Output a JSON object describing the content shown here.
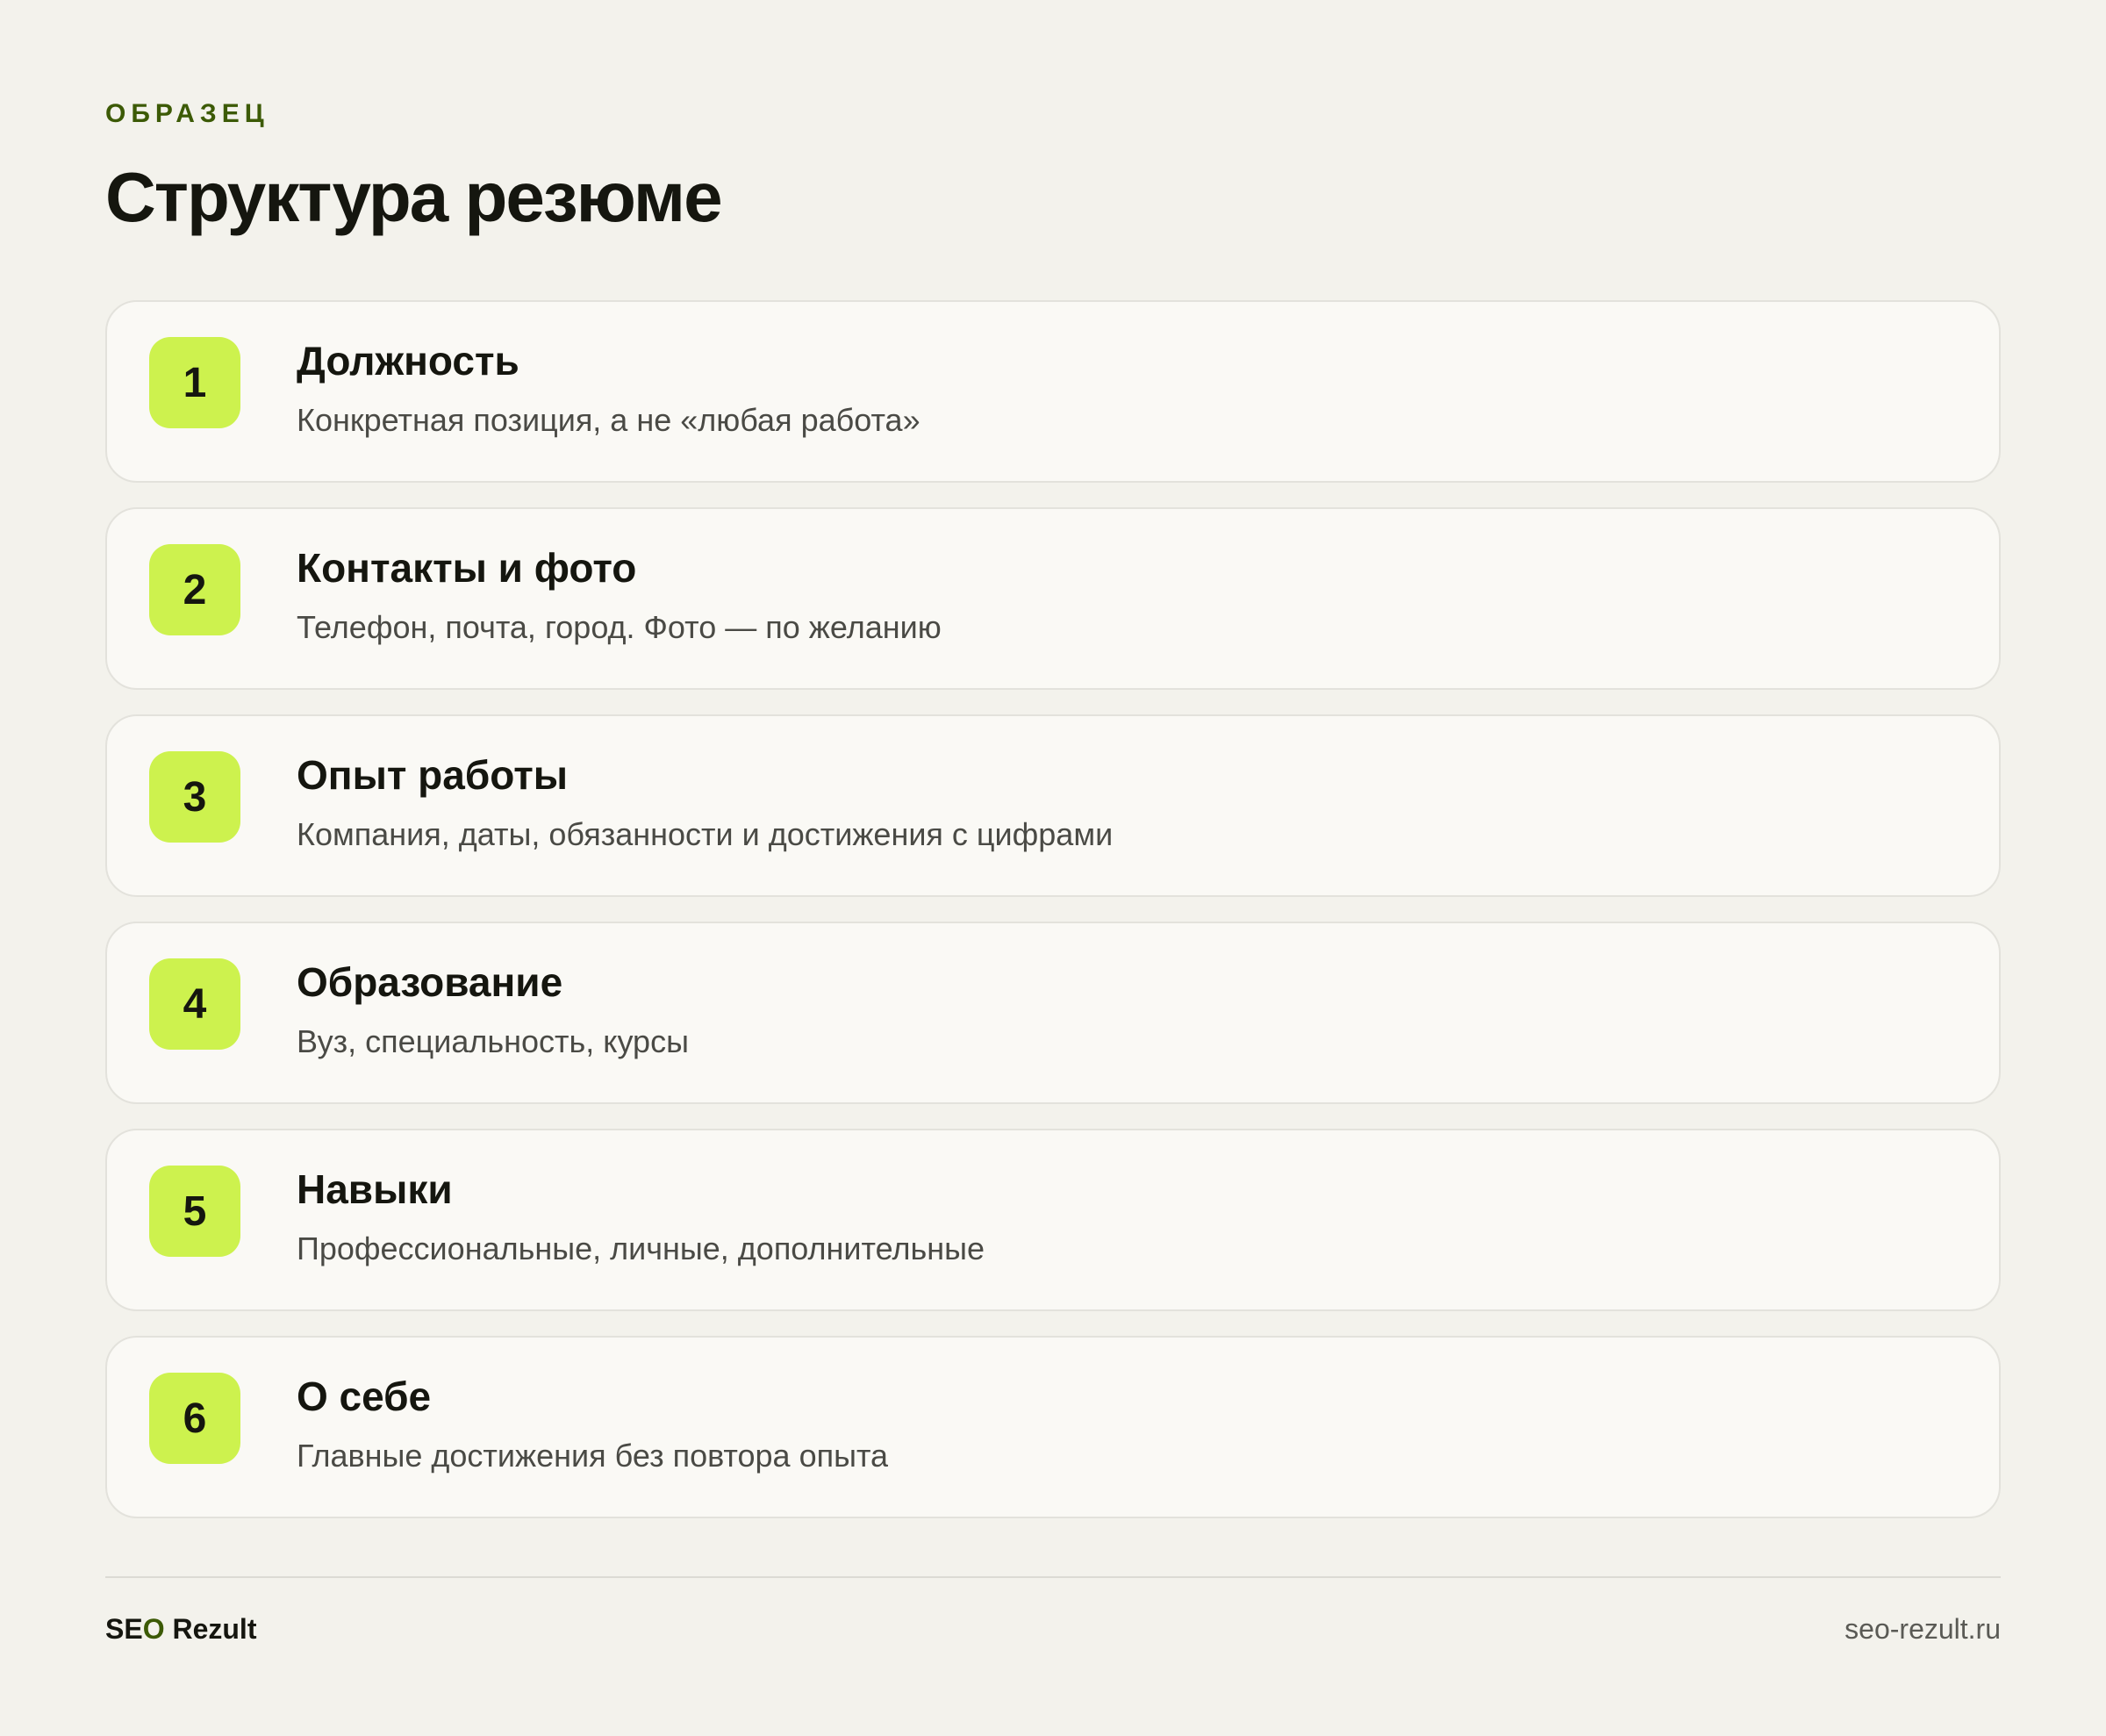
{
  "header": {
    "eyebrow": "ОБРАЗЕЦ",
    "title": "Структура резюме"
  },
  "items": [
    {
      "number": "1",
      "title": "Должность",
      "description": "Конкретная позиция, а не «любая работа»"
    },
    {
      "number": "2",
      "title": "Контакты и фото",
      "description": "Телефон, почта, город. Фото — по желанию"
    },
    {
      "number": "3",
      "title": "Опыт работы",
      "description": "Компания, даты, обязанности и достижения с цифрами"
    },
    {
      "number": "4",
      "title": "Образование",
      "description": "Вуз, специальность, курсы"
    },
    {
      "number": "5",
      "title": "Навыки",
      "description": "Профессиональные, личные, дополнительные"
    },
    {
      "number": "6",
      "title": "О себе",
      "description": "Главные достижения без повтора опыта"
    }
  ],
  "footer": {
    "brand_part1": "SE",
    "brand_part2": "O",
    "brand_part3": " Rezult",
    "site": "seo-rezult.ru"
  },
  "colors": {
    "background": "#f3f2ec",
    "card": "#faf9f5",
    "badge": "#cdf24e",
    "accent": "#3c5a06"
  }
}
